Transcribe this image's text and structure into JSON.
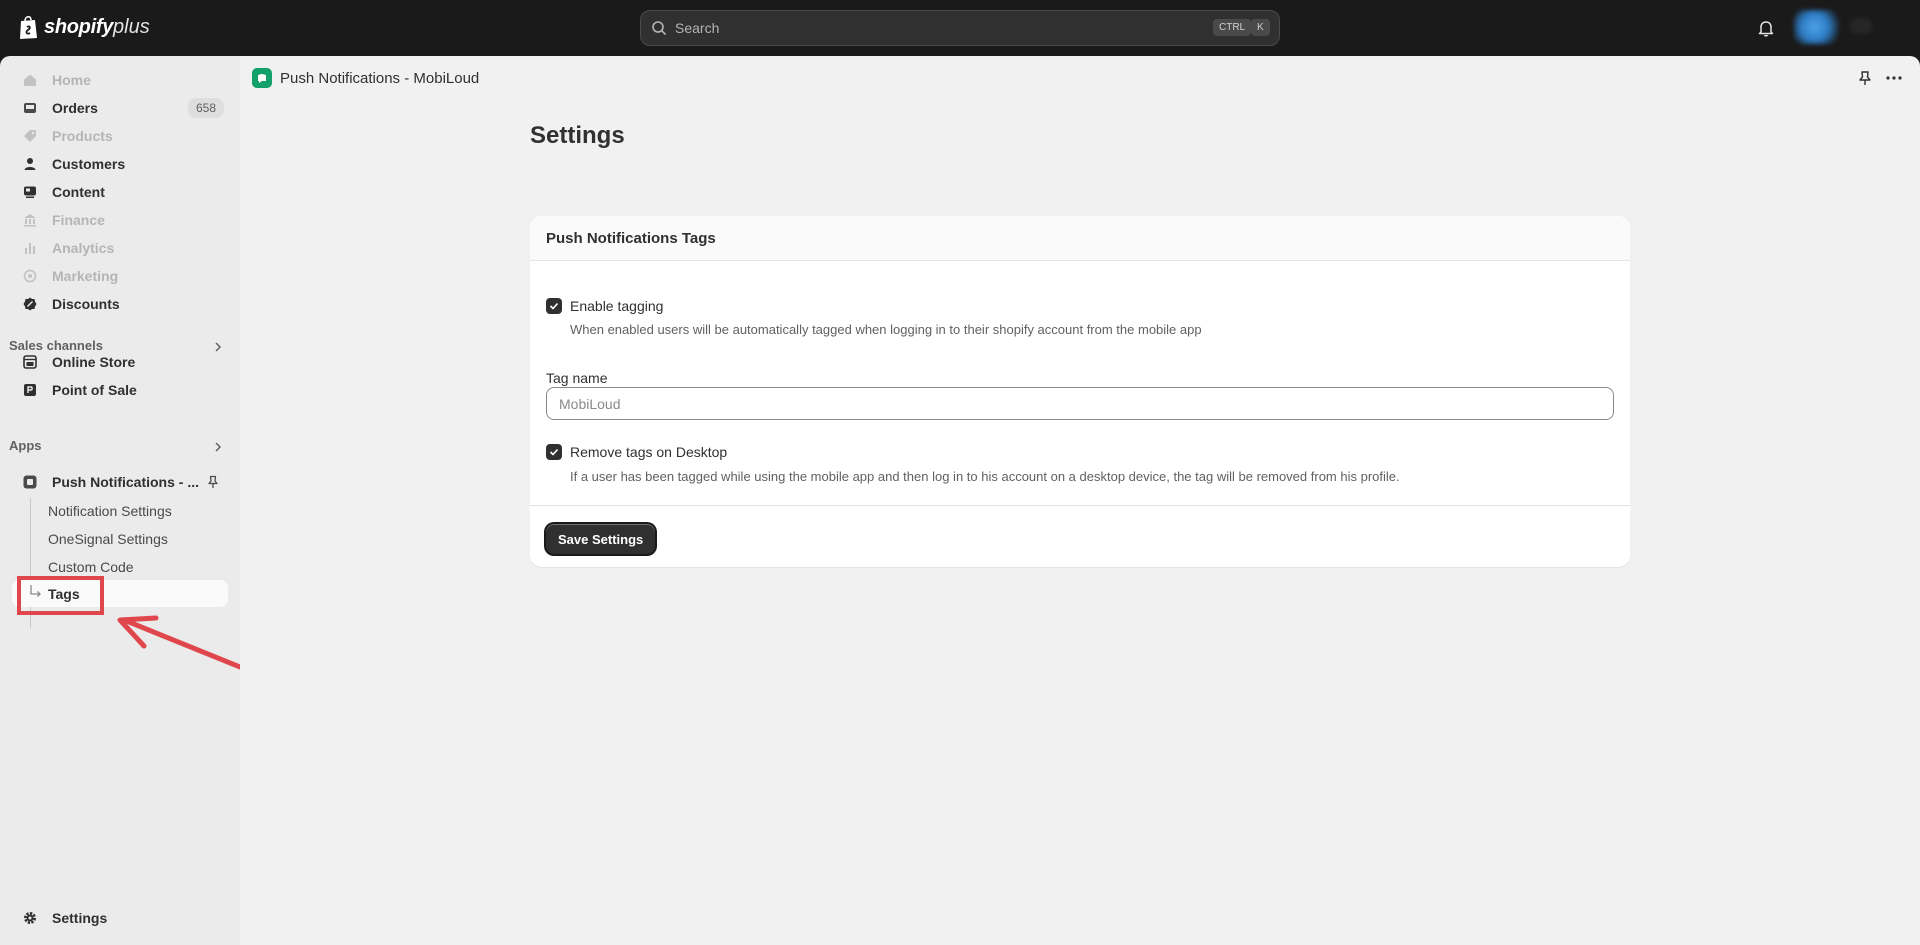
{
  "topbar": {
    "logo_word": "shopify",
    "logo_plus": "plus",
    "search_placeholder": "Search",
    "kbd_ctrl": "CTRL",
    "kbd_k": "K"
  },
  "sidebar": {
    "items": [
      {
        "label": "Home",
        "icon": "home-icon",
        "disabled": true
      },
      {
        "label": "Orders",
        "icon": "inbox-icon",
        "badge": "658"
      },
      {
        "label": "Products",
        "icon": "tag-icon",
        "disabled": true
      },
      {
        "label": "Customers",
        "icon": "person-icon"
      },
      {
        "label": "Content",
        "icon": "content-icon"
      },
      {
        "label": "Finance",
        "icon": "bank-icon",
        "disabled": true
      },
      {
        "label": "Analytics",
        "icon": "bar-chart-icon",
        "disabled": true
      },
      {
        "label": "Marketing",
        "icon": "target-icon",
        "disabled": true
      },
      {
        "label": "Discounts",
        "icon": "discount-icon"
      }
    ],
    "sales_channels_title": "Sales channels",
    "online_store": "Online Store",
    "point_of_sale": "Point of Sale",
    "apps_title": "Apps",
    "app_name": "Push Notifications - ...",
    "sub_items": [
      "Notification Settings",
      "OneSignal Settings",
      "Custom Code"
    ],
    "tags": "Tags",
    "settings": "Settings"
  },
  "main": {
    "app_title": "Push Notifications - MobiLoud",
    "page_title": "Settings",
    "card": {
      "title": "Push Notifications Tags",
      "enable_tagging_label": "Enable tagging",
      "enable_tagging_checked": true,
      "enable_tagging_help": "When enabled users will be automatically tagged when logging in to their shopify account from the mobile app",
      "tag_name_label": "Tag name",
      "tag_name_placeholder": "MobiLoud",
      "remove_tags_label": "Remove tags on Desktop",
      "remove_tags_checked": true,
      "remove_tags_help": "If a user has been tagged while using the mobile app and then log in to his account on a desktop device, the tag will be removed from his profile.",
      "save_button": "Save Settings"
    }
  },
  "colors": {
    "accent": "#303030",
    "highlight": "#e0474c",
    "app_icon": "#12a16b"
  }
}
